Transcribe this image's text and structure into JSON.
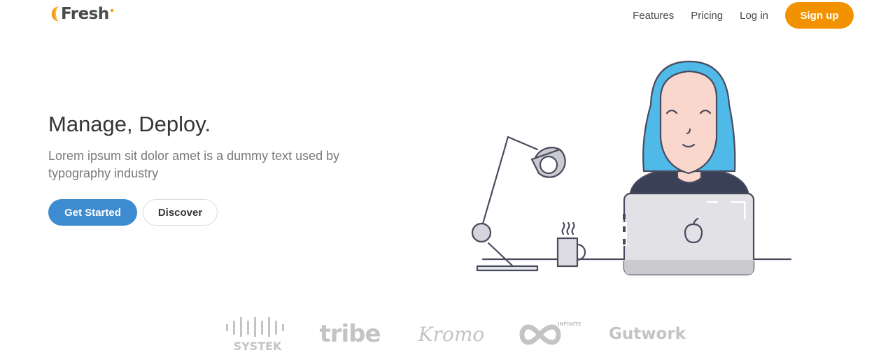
{
  "brand": {
    "name": "Fresh",
    "accent": "#f39200",
    "primary": "#3d8bd0"
  },
  "nav": {
    "links": [
      "Features",
      "Pricing",
      "Log in"
    ],
    "signup_label": "Sign up"
  },
  "hero": {
    "title": "Manage, Deploy.",
    "subtitle": "Lorem ipsum sit dolor amet is a dummy text used by typography industry",
    "primary_button": "Get Started",
    "secondary_button": "Discover",
    "illustration": "woman-at-laptop-illustration"
  },
  "clients": [
    {
      "name": "SYSTEK",
      "icon": "systek-logo"
    },
    {
      "name": "tribe",
      "icon": "tribe-logo"
    },
    {
      "name": "Kromo",
      "icon": "kromo-logo"
    },
    {
      "name": "INFINITE",
      "icon": "infinite-logo"
    },
    {
      "name": "Gutwork",
      "icon": "gutwork-logo"
    }
  ]
}
